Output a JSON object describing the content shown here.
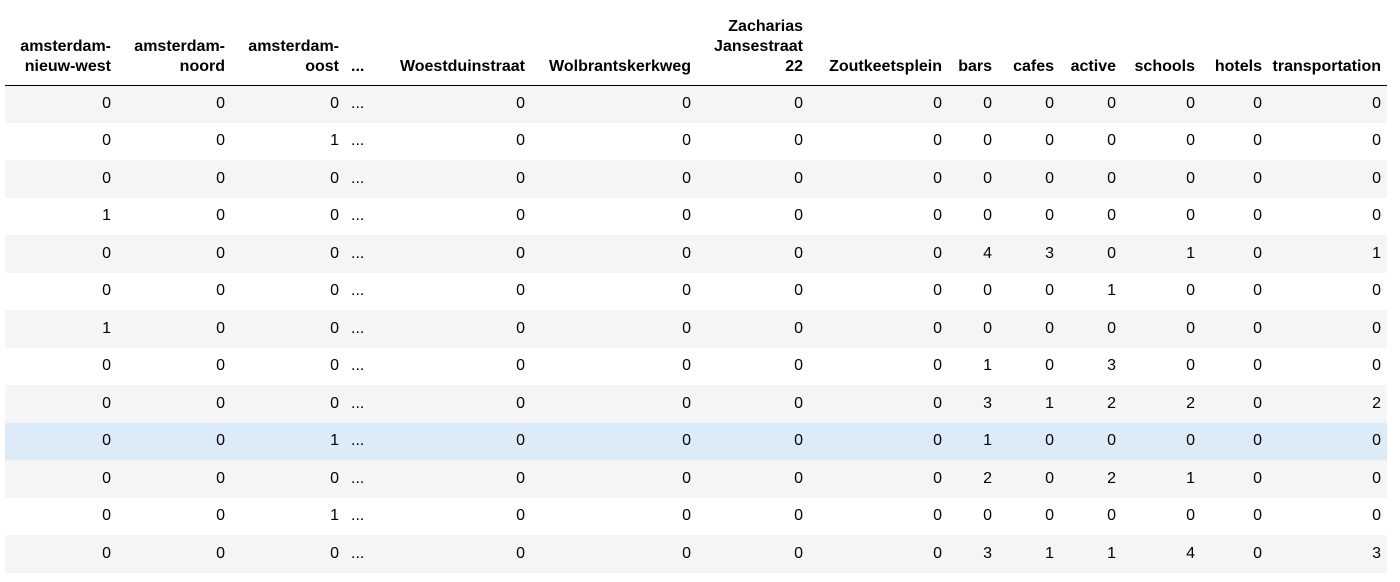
{
  "columns": [
    "amsterdam-nieuw-west",
    "amsterdam-noord",
    "amsterdam-oost",
    "...",
    "Woestduinstraat",
    "Wolbrantskerkweg",
    "Zacharias Jansestraat 22",
    "Zoutkeetsplein",
    "bars",
    "cafes",
    "active",
    "schools",
    "hotels",
    "transportation"
  ],
  "rows": [
    [
      "0",
      "0",
      "0",
      "...",
      "0",
      "0",
      "0",
      "0",
      "0",
      "0",
      "0",
      "0",
      "0",
      "0"
    ],
    [
      "0",
      "0",
      "1",
      "...",
      "0",
      "0",
      "0",
      "0",
      "0",
      "0",
      "0",
      "0",
      "0",
      "0"
    ],
    [
      "0",
      "0",
      "0",
      "...",
      "0",
      "0",
      "0",
      "0",
      "0",
      "0",
      "0",
      "0",
      "0",
      "0"
    ],
    [
      "1",
      "0",
      "0",
      "...",
      "0",
      "0",
      "0",
      "0",
      "0",
      "0",
      "0",
      "0",
      "0",
      "0"
    ],
    [
      "0",
      "0",
      "0",
      "...",
      "0",
      "0",
      "0",
      "0",
      "4",
      "3",
      "0",
      "1",
      "0",
      "1"
    ],
    [
      "0",
      "0",
      "0",
      "...",
      "0",
      "0",
      "0",
      "0",
      "0",
      "0",
      "1",
      "0",
      "0",
      "0"
    ],
    [
      "1",
      "0",
      "0",
      "...",
      "0",
      "0",
      "0",
      "0",
      "0",
      "0",
      "0",
      "0",
      "0",
      "0"
    ],
    [
      "0",
      "0",
      "0",
      "...",
      "0",
      "0",
      "0",
      "0",
      "1",
      "0",
      "3",
      "0",
      "0",
      "0"
    ],
    [
      "0",
      "0",
      "0",
      "...",
      "0",
      "0",
      "0",
      "0",
      "3",
      "1",
      "2",
      "2",
      "0",
      "2"
    ],
    [
      "0",
      "0",
      "1",
      "...",
      "0",
      "0",
      "0",
      "0",
      "1",
      "0",
      "0",
      "0",
      "0",
      "0"
    ],
    [
      "0",
      "0",
      "0",
      "...",
      "0",
      "0",
      "0",
      "0",
      "2",
      "0",
      "2",
      "1",
      "0",
      "0"
    ],
    [
      "0",
      "0",
      "1",
      "...",
      "0",
      "0",
      "0",
      "0",
      "0",
      "0",
      "0",
      "0",
      "0",
      "0"
    ],
    [
      "0",
      "0",
      "0",
      "...",
      "0",
      "0",
      "0",
      "0",
      "3",
      "1",
      "1",
      "4",
      "0",
      "3"
    ]
  ],
  "highlighted_row": 9,
  "colors": {
    "stripe": "#f5f5f5",
    "highlight": "#dcebf8",
    "header_rule": "#000000"
  }
}
